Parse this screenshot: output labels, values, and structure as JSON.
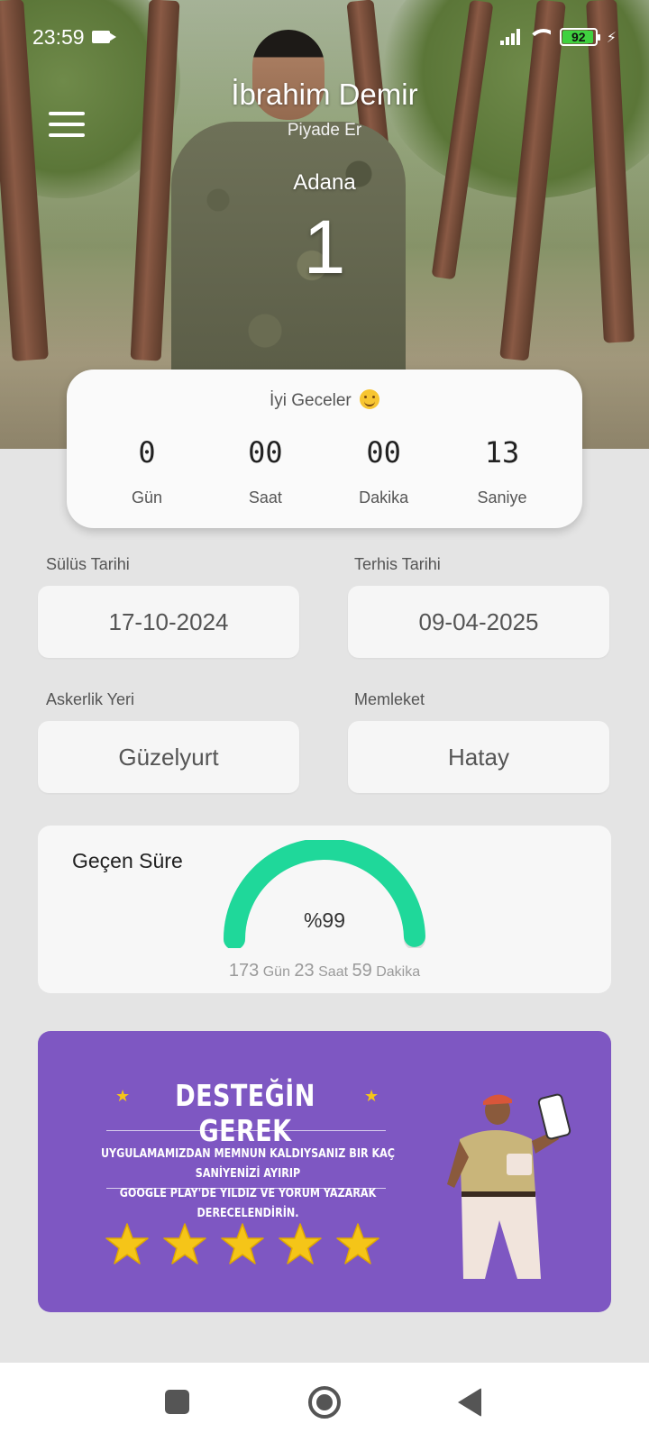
{
  "status_bar": {
    "time": "23:59",
    "battery": "92"
  },
  "profile": {
    "name": "İbrahim Demir",
    "rank": "Piyade Er",
    "location": "Adana",
    "big_number": "1"
  },
  "countdown": {
    "greeting": "İyi Geceler",
    "items": [
      {
        "value": "0",
        "label": "Gün"
      },
      {
        "value": "00",
        "label": "Saat"
      },
      {
        "value": "00",
        "label": "Dakika"
      },
      {
        "value": "13",
        "label": "Saniye"
      }
    ]
  },
  "fields": {
    "enlist_label": "Sülüs Tarihi",
    "enlist_value": "17-10-2024",
    "discharge_label": "Terhis Tarihi",
    "discharge_value": "09-04-2025",
    "service_place_label": "Askerlik Yeri",
    "service_place_value": "Güzelyurt",
    "hometown_label": "Memleket",
    "hometown_value": "Hatay"
  },
  "progress": {
    "title": "Geçen Süre",
    "percent_text": "%99",
    "percent": 99,
    "days": "173",
    "days_unit": "Gün",
    "hours": "23",
    "hours_unit": "Saat",
    "minutes": "59",
    "minutes_unit": "Dakika",
    "color": "#1fd89a"
  },
  "banner": {
    "title": "DESTEĞİN GEREK",
    "text_line1": "UYGULAMAMIZDAN MEMNUN KALDIYSANIZ BIR KAÇ SANİYENİZİ AYIRIP",
    "text_line2": "GOOGLE PLAY'DE YILDIZ VE YORUM YAZARAK DERECELENDİRİN.",
    "stars": 5,
    "background": "#7e57c2"
  }
}
